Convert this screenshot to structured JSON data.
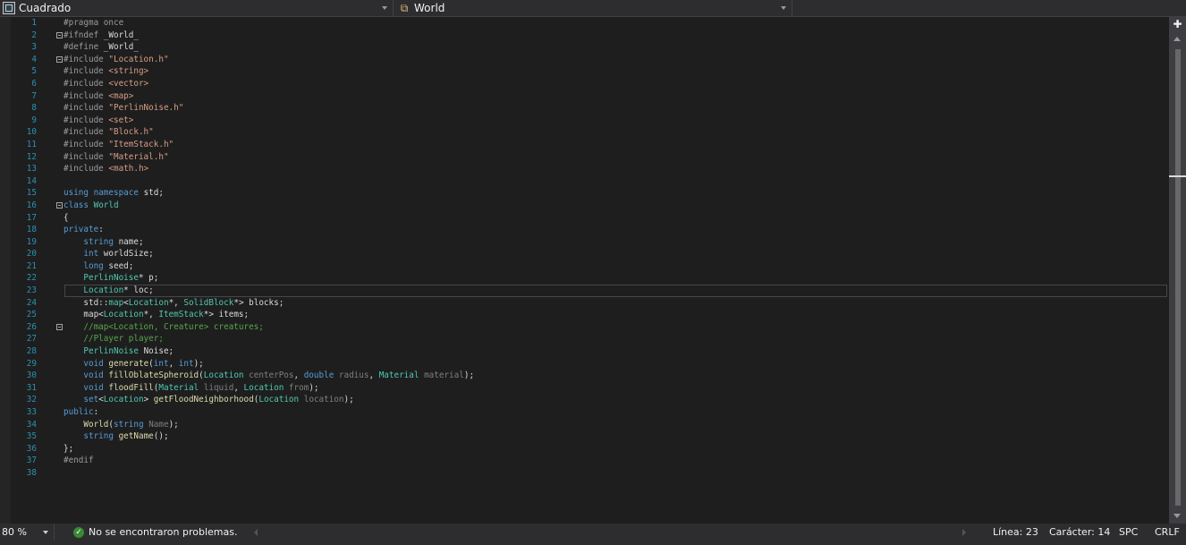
{
  "navbar": {
    "file_combo": "Cuadrado",
    "scope_combo": "World",
    "member_combo": ""
  },
  "editor": {
    "current_line": 23,
    "lines": [
      {
        "n": "1",
        "fold": false,
        "tokens": [
          {
            "c": "pp",
            "t": "#pragma once"
          }
        ]
      },
      {
        "n": "2",
        "fold": true,
        "tokens": [
          {
            "c": "pp",
            "t": "#ifndef "
          },
          {
            "c": "",
            "t": "_World_"
          }
        ]
      },
      {
        "n": "3",
        "fold": false,
        "tokens": [
          {
            "c": "pp",
            "t": "#define "
          },
          {
            "c": "",
            "t": "_World_"
          }
        ]
      },
      {
        "n": "4",
        "fold": true,
        "tokens": [
          {
            "c": "pp",
            "t": "#include "
          },
          {
            "c": "str",
            "t": "\"Location.h\""
          }
        ]
      },
      {
        "n": "5",
        "fold": false,
        "tokens": [
          {
            "c": "pp",
            "t": "#include "
          },
          {
            "c": "str",
            "t": "<string>"
          }
        ]
      },
      {
        "n": "6",
        "fold": false,
        "tokens": [
          {
            "c": "pp",
            "t": "#include "
          },
          {
            "c": "str",
            "t": "<vector>"
          }
        ]
      },
      {
        "n": "7",
        "fold": false,
        "tokens": [
          {
            "c": "pp",
            "t": "#include "
          },
          {
            "c": "str",
            "t": "<map>"
          }
        ]
      },
      {
        "n": "8",
        "fold": false,
        "tokens": [
          {
            "c": "pp",
            "t": "#include "
          },
          {
            "c": "str",
            "t": "\"PerlinNoise.h\""
          }
        ]
      },
      {
        "n": "9",
        "fold": false,
        "tokens": [
          {
            "c": "pp",
            "t": "#include "
          },
          {
            "c": "str",
            "t": "<set>"
          }
        ]
      },
      {
        "n": "10",
        "fold": false,
        "tokens": [
          {
            "c": "pp",
            "t": "#include "
          },
          {
            "c": "str",
            "t": "\"Block.h\""
          }
        ]
      },
      {
        "n": "11",
        "fold": false,
        "tokens": [
          {
            "c": "pp",
            "t": "#include "
          },
          {
            "c": "str",
            "t": "\"ItemStack.h\""
          }
        ]
      },
      {
        "n": "12",
        "fold": false,
        "tokens": [
          {
            "c": "pp",
            "t": "#include "
          },
          {
            "c": "str",
            "t": "\"Material.h\""
          }
        ]
      },
      {
        "n": "13",
        "fold": false,
        "tokens": [
          {
            "c": "pp",
            "t": "#include "
          },
          {
            "c": "str",
            "t": "<math.h>"
          }
        ]
      },
      {
        "n": "14",
        "fold": false,
        "tokens": []
      },
      {
        "n": "15",
        "fold": false,
        "tokens": [
          {
            "c": "kw",
            "t": "using namespace "
          },
          {
            "c": "",
            "t": "std;"
          }
        ]
      },
      {
        "n": "16",
        "fold": true,
        "tokens": [
          {
            "c": "kw",
            "t": "class "
          },
          {
            "c": "ty",
            "t": "World"
          }
        ]
      },
      {
        "n": "17",
        "fold": false,
        "tokens": [
          {
            "c": "",
            "t": "{"
          }
        ]
      },
      {
        "n": "18",
        "fold": false,
        "tokens": [
          {
            "c": "kw",
            "t": "private"
          },
          {
            "c": "",
            "t": ":"
          }
        ]
      },
      {
        "n": "19",
        "fold": false,
        "tokens": [
          {
            "c": "",
            "t": "    "
          },
          {
            "c": "kw",
            "t": "string "
          },
          {
            "c": "",
            "t": "name;"
          }
        ]
      },
      {
        "n": "20",
        "fold": false,
        "tokens": [
          {
            "c": "",
            "t": "    "
          },
          {
            "c": "kw",
            "t": "int "
          },
          {
            "c": "",
            "t": "worldSize;"
          }
        ]
      },
      {
        "n": "21",
        "fold": false,
        "tokens": [
          {
            "c": "",
            "t": "    "
          },
          {
            "c": "kw",
            "t": "long "
          },
          {
            "c": "",
            "t": "seed;"
          }
        ]
      },
      {
        "n": "22",
        "fold": false,
        "tokens": [
          {
            "c": "",
            "t": "    "
          },
          {
            "c": "ty",
            "t": "PerlinNoise"
          },
          {
            "c": "",
            "t": "* p;"
          }
        ]
      },
      {
        "n": "23",
        "fold": false,
        "tokens": [
          {
            "c": "",
            "t": "    "
          },
          {
            "c": "ty",
            "t": "Location"
          },
          {
            "c": "",
            "t": "* loc;"
          }
        ]
      },
      {
        "n": "24",
        "fold": false,
        "tokens": [
          {
            "c": "",
            "t": "    std::"
          },
          {
            "c": "ty",
            "t": "map"
          },
          {
            "c": "",
            "t": "<"
          },
          {
            "c": "ty",
            "t": "Location"
          },
          {
            "c": "",
            "t": "*, "
          },
          {
            "c": "ty",
            "t": "SolidBlock"
          },
          {
            "c": "",
            "t": "*> blocks;"
          }
        ]
      },
      {
        "n": "25",
        "fold": false,
        "tokens": [
          {
            "c": "",
            "t": "    map<"
          },
          {
            "c": "ty",
            "t": "Location"
          },
          {
            "c": "",
            "t": "*, "
          },
          {
            "c": "ty",
            "t": "ItemStack"
          },
          {
            "c": "",
            "t": "*> items;"
          }
        ]
      },
      {
        "n": "26",
        "fold": true,
        "tokens": [
          {
            "c": "",
            "t": "    "
          },
          {
            "c": "cm",
            "t": "//map<Location, Creature> creatures;"
          }
        ]
      },
      {
        "n": "27",
        "fold": false,
        "tokens": [
          {
            "c": "",
            "t": "    "
          },
          {
            "c": "cm",
            "t": "//Player player;"
          }
        ]
      },
      {
        "n": "28",
        "fold": false,
        "tokens": [
          {
            "c": "",
            "t": "    "
          },
          {
            "c": "ty",
            "t": "PerlinNoise "
          },
          {
            "c": "",
            "t": "Noise;"
          }
        ]
      },
      {
        "n": "29",
        "fold": false,
        "tokens": [
          {
            "c": "",
            "t": "    "
          },
          {
            "c": "kw",
            "t": "void "
          },
          {
            "c": "fn",
            "t": "generate"
          },
          {
            "c": "",
            "t": "("
          },
          {
            "c": "kw",
            "t": "int"
          },
          {
            "c": "",
            "t": ", "
          },
          {
            "c": "kw",
            "t": "int"
          },
          {
            "c": "",
            "t": ");"
          }
        ]
      },
      {
        "n": "30",
        "fold": false,
        "tokens": [
          {
            "c": "",
            "t": "    "
          },
          {
            "c": "kw",
            "t": "void "
          },
          {
            "c": "fn",
            "t": "fillOblateSpheroid"
          },
          {
            "c": "",
            "t": "("
          },
          {
            "c": "ty",
            "t": "Location "
          },
          {
            "c": "pa",
            "t": "centerPos"
          },
          {
            "c": "",
            "t": ", "
          },
          {
            "c": "kw",
            "t": "double "
          },
          {
            "c": "pa",
            "t": "radius"
          },
          {
            "c": "",
            "t": ", "
          },
          {
            "c": "ty",
            "t": "Material "
          },
          {
            "c": "pa",
            "t": "material"
          },
          {
            "c": "",
            "t": ");"
          }
        ]
      },
      {
        "n": "31",
        "fold": false,
        "tokens": [
          {
            "c": "",
            "t": "    "
          },
          {
            "c": "kw",
            "t": "void "
          },
          {
            "c": "fn",
            "t": "floodFill"
          },
          {
            "c": "",
            "t": "("
          },
          {
            "c": "ty",
            "t": "Material "
          },
          {
            "c": "pa",
            "t": "liquid"
          },
          {
            "c": "",
            "t": ", "
          },
          {
            "c": "ty",
            "t": "Location "
          },
          {
            "c": "pa",
            "t": "from"
          },
          {
            "c": "",
            "t": ");"
          }
        ]
      },
      {
        "n": "32",
        "fold": false,
        "tokens": [
          {
            "c": "",
            "t": "    "
          },
          {
            "c": "kw",
            "t": "set"
          },
          {
            "c": "",
            "t": "<"
          },
          {
            "c": "ty",
            "t": "Location"
          },
          {
            "c": "",
            "t": "> "
          },
          {
            "c": "fn",
            "t": "getFloodNeighborhood"
          },
          {
            "c": "",
            "t": "("
          },
          {
            "c": "ty",
            "t": "Location "
          },
          {
            "c": "pa",
            "t": "location"
          },
          {
            "c": "",
            "t": ");"
          }
        ]
      },
      {
        "n": "33",
        "fold": false,
        "tokens": [
          {
            "c": "kw",
            "t": "public"
          },
          {
            "c": "",
            "t": ":"
          }
        ]
      },
      {
        "n": "34",
        "fold": false,
        "tokens": [
          {
            "c": "",
            "t": "    "
          },
          {
            "c": "fn",
            "t": "World"
          },
          {
            "c": "",
            "t": "("
          },
          {
            "c": "kw",
            "t": "string "
          },
          {
            "c": "pa",
            "t": "Name"
          },
          {
            "c": "",
            "t": ");"
          }
        ]
      },
      {
        "n": "35",
        "fold": false,
        "tokens": [
          {
            "c": "",
            "t": "    "
          },
          {
            "c": "kw",
            "t": "string "
          },
          {
            "c": "fn",
            "t": "getName"
          },
          {
            "c": "",
            "t": "();"
          }
        ]
      },
      {
        "n": "36",
        "fold": false,
        "tokens": [
          {
            "c": "",
            "t": "};"
          }
        ]
      },
      {
        "n": "37",
        "fold": false,
        "tokens": [
          {
            "c": "pp",
            "t": "#endif"
          }
        ]
      },
      {
        "n": "38",
        "fold": false,
        "tokens": []
      }
    ]
  },
  "statusbar": {
    "zoom": "80 %",
    "problems": "No se encontraron problemas.",
    "line": "Línea: 23",
    "char": "Carácter: 14",
    "indent": "SPC",
    "eol": "CRLF"
  },
  "colors": {
    "background": "#1e1e1e",
    "keyword": "#569cd6",
    "type": "#4ec9b0",
    "string": "#d69d85",
    "function": "#dcdcaa",
    "comment": "#57a64a",
    "line_number": "#2b91af"
  }
}
